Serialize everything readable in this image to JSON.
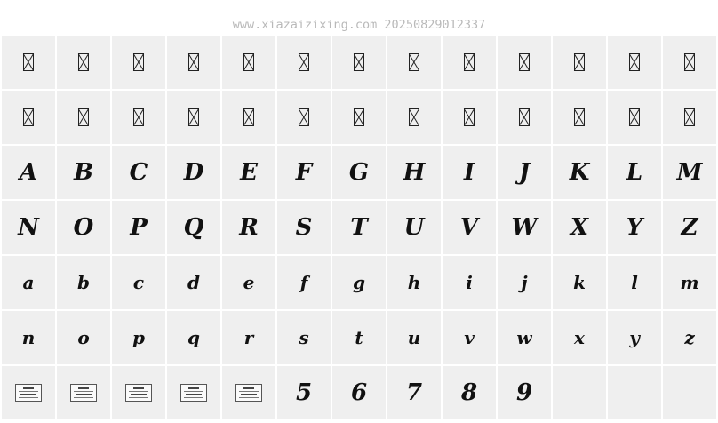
{
  "header": {
    "watermark": "www.xiazaizixing.com 20250829012337"
  },
  "grid": {
    "columns": 13,
    "missing_glyph_count": 26,
    "uppercase": [
      "A",
      "B",
      "C",
      "D",
      "E",
      "F",
      "G",
      "H",
      "I",
      "J",
      "K",
      "L",
      "M",
      "N",
      "O",
      "P",
      "Q",
      "R",
      "S",
      "T",
      "U",
      "V",
      "W",
      "X",
      "Y",
      "Z"
    ],
    "lowercase": [
      "a",
      "b",
      "c",
      "d",
      "e",
      "f",
      "g",
      "h",
      "i",
      "j",
      "k",
      "l",
      "m",
      "n",
      "o",
      "p",
      "q",
      "r",
      "s",
      "t",
      "u",
      "v",
      "w",
      "x",
      "y",
      "z"
    ],
    "label_tile_count": 5,
    "digits": [
      "5",
      "6",
      "7",
      "8",
      "9"
    ],
    "empty_tile_count": 3
  }
}
